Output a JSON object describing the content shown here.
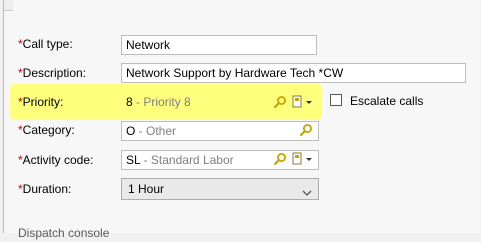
{
  "call_type": {
    "label": "Call type:",
    "required_mark": "*",
    "value": "Network"
  },
  "description": {
    "label": "Description:",
    "required_mark": "*",
    "value": "Network Support by Hardware Tech *CW"
  },
  "priority": {
    "label": "Priority:",
    "required_mark": "*",
    "code": "8",
    "separator": " - ",
    "text": "Priority 8"
  },
  "escalate": {
    "label": "Escalate calls",
    "checked": false
  },
  "category": {
    "label": "Category:",
    "required_mark": "*",
    "code": "O",
    "separator": " - ",
    "text": "Other"
  },
  "activity_code": {
    "label": "Activity code:",
    "required_mark": "*",
    "code": "SL",
    "separator": " - ",
    "text": "Standard Labor"
  },
  "duration": {
    "label": "Duration:",
    "required_mark": "*",
    "value": "1 Hour"
  },
  "dispatch_section": {
    "label": "Dispatch console"
  },
  "colors": {
    "highlight": "#ffff70",
    "required": "#d40000",
    "icon_gold": "#c8a200"
  }
}
